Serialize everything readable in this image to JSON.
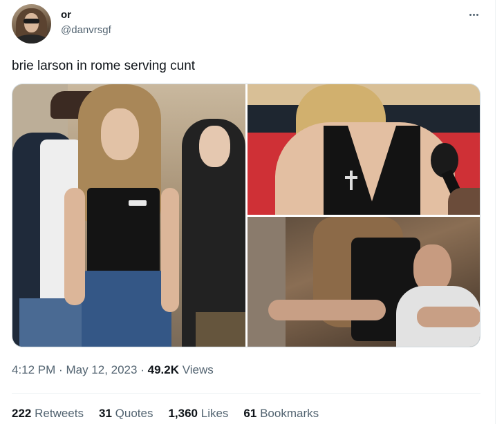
{
  "author": {
    "display_name": "or",
    "handle": "@danvrsgf"
  },
  "tweet": {
    "text": "brie larson in rome serving cunt",
    "time": "4:12 PM",
    "separator": "·",
    "date": "May 12, 2023",
    "views_count": "49.2K",
    "views_label": "Views"
  },
  "stats": {
    "retweets_count": "222",
    "retweets_label": "Retweets",
    "quotes_count": "31",
    "quotes_label": "Quotes",
    "likes_count": "1,360",
    "likes_label": "Likes",
    "bookmarks_count": "61",
    "bookmarks_label": "Bookmarks"
  },
  "icons": {
    "more": "more-horizontal-icon"
  },
  "colors": {
    "text_primary": "#0f1419",
    "text_secondary": "#536471",
    "border": "#cfd9de"
  }
}
